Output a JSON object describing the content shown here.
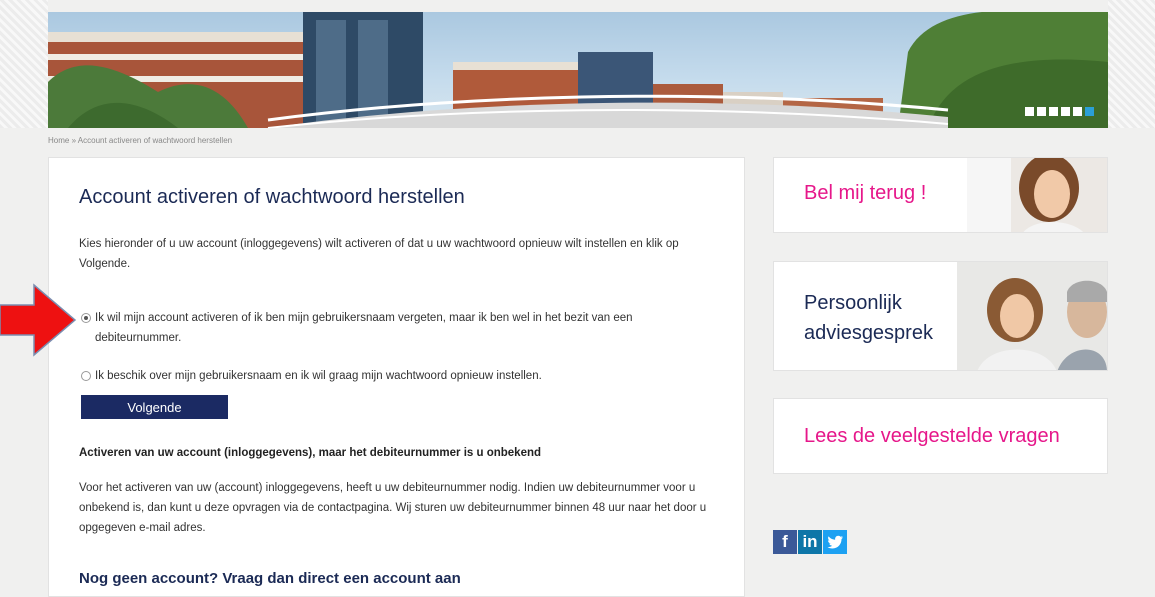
{
  "breadcrumb": "Home » Account activeren of wachtwoord herstellen",
  "hero": {
    "slides_total": 6,
    "active_slide": 6
  },
  "main": {
    "title": "Account activeren of wachtwoord herstellen",
    "intro": "Kies hieronder of u uw account (inloggegevens) wilt activeren of dat u uw wachtwoord opnieuw wilt instellen en klik op Volgende.",
    "options": [
      {
        "label": "Ik wil mijn account activeren of ik ben mijn gebruikersnaam vergeten, maar ik ben wel in het bezit van een debiteurnummer.",
        "checked": true
      },
      {
        "label": "Ik beschik over mijn gebruikersnaam en ik wil graag mijn wachtwoord opnieuw instellen.",
        "checked": false
      }
    ],
    "next_button": "Volgende",
    "section1_heading": "Activeren van uw account (inloggegevens), maar het debiteurnummer is u onbekend",
    "section1_text": "Voor het activeren van uw (account) inloggegevens, heeft u uw debiteurnummer nodig. Indien uw debiteurnummer voor u onbekend is, dan kunt u deze opvragen via de contactpagina. Wij sturen uw debiteurnummer binnen 48 uur naar het door u opgegeven e-mail adres.",
    "section2_heading": "Nog geen account?  Vraag dan direct een account aan"
  },
  "sidebar": {
    "callback": "Bel mij terug !",
    "advice_line1": "Persoonlijk",
    "advice_line2": "adviesgesprek",
    "faq": "Lees de veelgestelde vragen"
  },
  "social": {
    "facebook": "f",
    "linkedin": "in"
  },
  "colors": {
    "navy": "#1b2a63",
    "pink": "#e6178a",
    "arrow_red": "#ee1111",
    "facebook": "#3b5998",
    "linkedin": "#0e76a8",
    "twitter": "#1da1f2"
  },
  "icons": [
    "red-arrow-icon",
    "facebook-icon",
    "linkedin-icon",
    "twitter-icon"
  ]
}
